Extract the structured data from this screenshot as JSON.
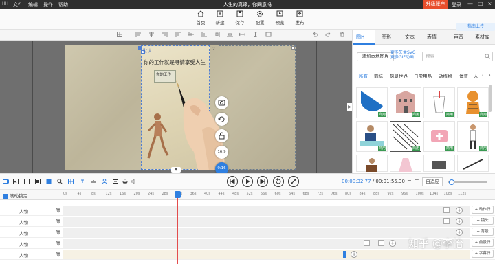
{
  "menubar": {
    "logo": "HH",
    "items": [
      "文件",
      "编辑",
      "操作",
      "帮助"
    ],
    "title": "人生的真谛，你同意吗",
    "vip_label": "升级账户",
    "login_label": "登录",
    "window_controls": [
      "—",
      "□",
      "×"
    ]
  },
  "toolbar": {
    "buttons": [
      {
        "label": "首页",
        "icon": "home-icon"
      },
      {
        "label": "新建",
        "icon": "plus-square-icon"
      },
      {
        "label": "保存",
        "icon": "save-icon"
      },
      {
        "label": "配置",
        "icon": "gear-icon"
      },
      {
        "label": "预览",
        "icon": "preview-icon"
      },
      {
        "label": "发布",
        "icon": "publish-icon"
      }
    ]
  },
  "stage": {
    "scene_tag": "默认",
    "scene2_number": "2",
    "heading_text": "你的工作就是寻情享受人生",
    "box_text": "你的工作",
    "right_tools": [
      {
        "label": "",
        "icon": "camera-icon"
      },
      {
        "label": "",
        "icon": "rotate-icon"
      },
      {
        "label": "",
        "icon": "unlock-icon"
      },
      {
        "label": "16:9"
      },
      {
        "label": "9:16",
        "active": true
      },
      {
        "label": "",
        "icon": "edit-icon"
      }
    ]
  },
  "panel": {
    "tabs": [
      {
        "label": "图H",
        "icon": "image-icon",
        "active": true
      },
      {
        "label": "图形",
        "icon": "shape-icon"
      },
      {
        "label": "文本",
        "icon": "text-icon"
      },
      {
        "label": "表情",
        "icon": "person-icon"
      },
      {
        "label": "声音",
        "icon": "music-icon"
      },
      {
        "label": "素材库",
        "icon": "library-icon"
      }
    ],
    "side_button": "指南上传",
    "add_image_label": "添加本地图片",
    "support_line1": "更多矢量SVG",
    "support_line2": "更多GIF动画",
    "search_placeholder": "搜索",
    "categories": [
      "所有",
      "箭标",
      "风景世界",
      "日常用品",
      "动植物",
      "体育",
      "人"
    ],
    "active_category": "所有",
    "thumb_badge": "商用"
  },
  "playback": {
    "current_time": "00:00:32.77",
    "total_time": "00:01:55.30",
    "adapt_label": "自适应",
    "zoom_level": 0.05
  },
  "timeline": {
    "lock_label": "滚动锁定",
    "ticks": [
      "0s",
      "4s",
      "8s",
      "12s",
      "16s",
      "20s",
      "24s",
      "28s",
      "32s",
      "36s",
      "40s",
      "44s",
      "48s",
      "52s",
      "56s",
      "60s",
      "64s",
      "68s",
      "72s",
      "76s",
      "80s",
      "84s",
      "88s",
      "92s",
      "96s",
      "100s",
      "104s",
      "108s",
      "112s"
    ],
    "tracks": [
      {
        "name": "人物"
      },
      {
        "name": "人物"
      },
      {
        "name": "人物"
      },
      {
        "name": "人物"
      },
      {
        "name": "人物"
      }
    ],
    "add_buttons": [
      "+ 动作行",
      "+ 镜头",
      "+ 背景",
      "+ 前景行",
      "+ 字幕行"
    ],
    "playhead_time": "32s"
  },
  "watermark": "知乎 @李怡",
  "colors": {
    "accent": "#2f7fe0",
    "vip": "#e84e2c",
    "menubar": "#2f2f2f",
    "playhead": "#e34d4d"
  }
}
